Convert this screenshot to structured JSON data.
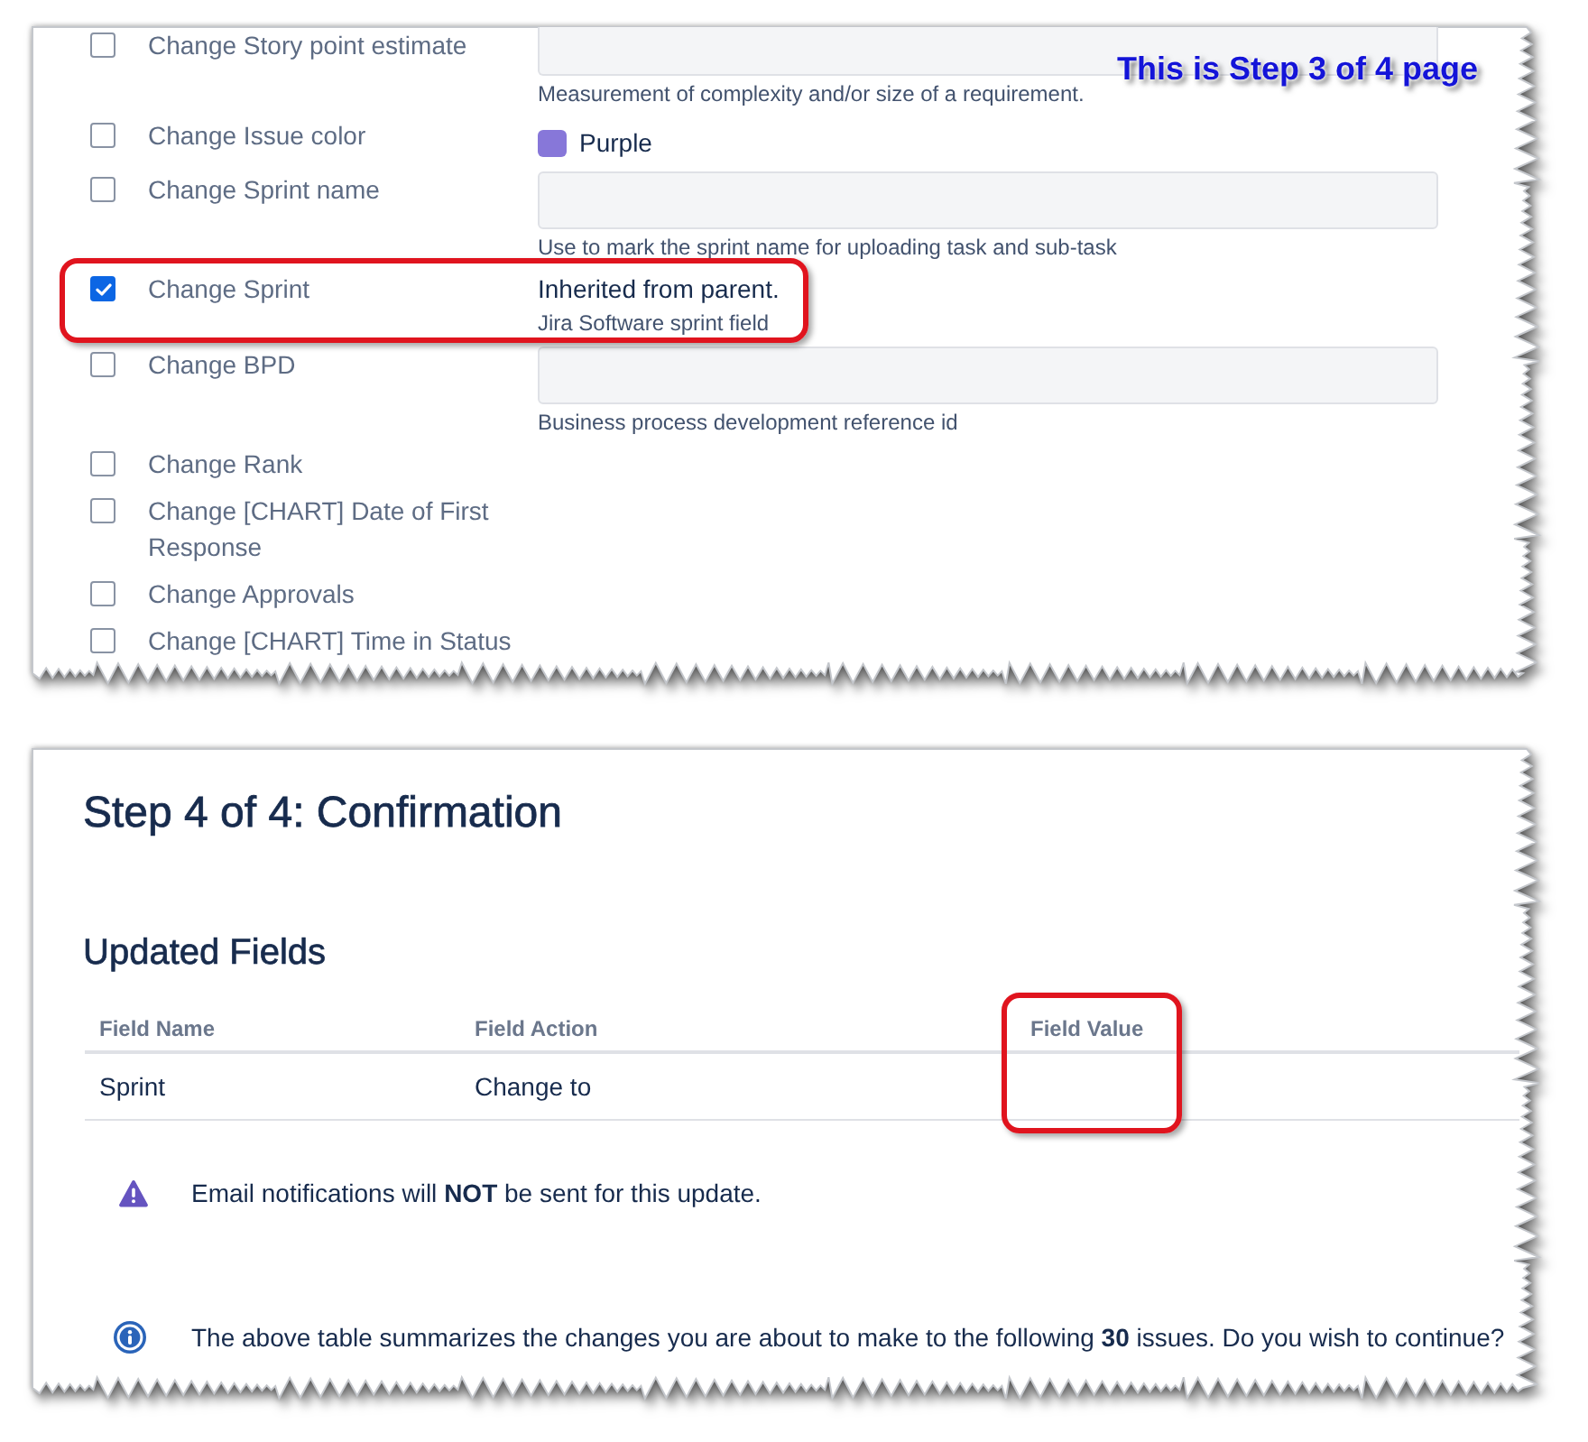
{
  "step3_panel": {
    "annotation": "This is Step 3 of 4 page",
    "fields": [
      {
        "kind": "input",
        "label": "Change Story point estimate",
        "checked": false,
        "help": "Measurement of complexity and/or size of a requirement."
      },
      {
        "kind": "color",
        "label": "Change Issue color",
        "checked": false,
        "value": "Purple",
        "color": "#8777d9"
      },
      {
        "kind": "input",
        "label": "Change Sprint name",
        "checked": false,
        "help": "Use to mark the sprint name for uploading task and sub-task"
      },
      {
        "kind": "text",
        "label": "Change Sprint",
        "checked": true,
        "highlighted": true,
        "value": "Inherited from parent.",
        "help": "Jira Software sprint field"
      },
      {
        "kind": "input",
        "label": "Change BPD",
        "checked": false,
        "help": "Business process development reference id"
      },
      {
        "kind": "label_only",
        "label": "Change Rank",
        "checked": false
      },
      {
        "kind": "label_only",
        "label": "Change [CHART] Date of First Response",
        "checked": false
      },
      {
        "kind": "label_only",
        "label": "Change Approvals",
        "checked": false
      },
      {
        "kind": "label_only",
        "label": "Change [CHART] Time in Status",
        "checked": false
      }
    ]
  },
  "step4_panel": {
    "title": "Step 4 of 4: Confirmation",
    "section_title": "Updated Fields",
    "table": {
      "columns": [
        {
          "label": "Field Name"
        },
        {
          "label": "Field Action"
        },
        {
          "label": "Field Value",
          "highlighted": true
        }
      ],
      "rows": [
        {
          "field_name": "Sprint",
          "field_action": "Change to"
        }
      ]
    },
    "notices": [
      {
        "kind": "warning",
        "text": "Email notifications will **NOT** be sent for this update."
      },
      {
        "kind": "info",
        "text": "The above table summarizes the changes you are about to make to the following **30** issues. Do you wish to continue?"
      }
    ]
  }
}
